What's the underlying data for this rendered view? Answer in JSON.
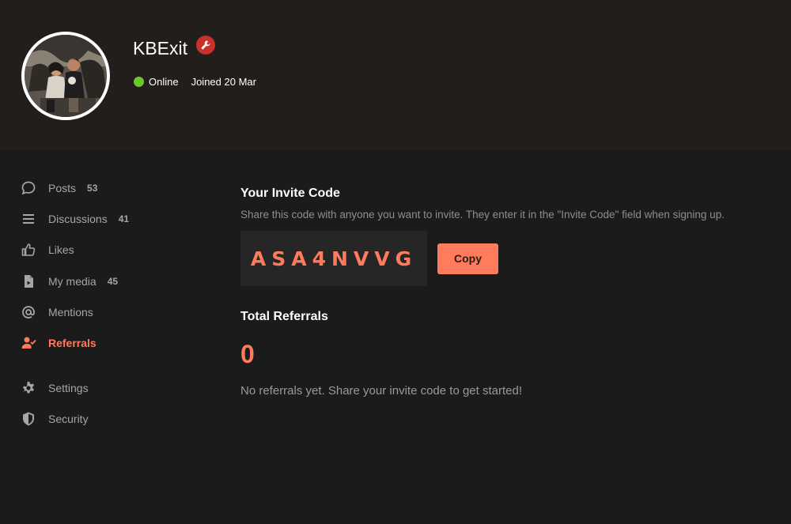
{
  "profile": {
    "username": "KBExit",
    "status": "Online",
    "joined": "Joined 20 Mar",
    "badge_icon": "wrench-icon",
    "status_color": "#6cc72f",
    "badge_color": "#c9302c"
  },
  "sidebar": {
    "items": [
      {
        "label": "Posts",
        "count": "53",
        "icon": "speech-bubble-icon",
        "active": false
      },
      {
        "label": "Discussions",
        "count": "41",
        "icon": "list-icon",
        "active": false
      },
      {
        "label": "Likes",
        "count": "",
        "icon": "thumbs-up-icon",
        "active": false
      },
      {
        "label": "My media",
        "count": "45",
        "icon": "media-file-icon",
        "active": false
      },
      {
        "label": "Mentions",
        "count": "",
        "icon": "at-sign-icon",
        "active": false
      },
      {
        "label": "Referrals",
        "count": "",
        "icon": "user-check-icon",
        "active": true
      },
      {
        "label": "Settings",
        "count": "",
        "icon": "gear-icon",
        "active": false
      },
      {
        "label": "Security",
        "count": "",
        "icon": "shield-icon",
        "active": false
      }
    ]
  },
  "invite": {
    "title": "Your Invite Code",
    "description": "Share this code with anyone you want to invite. They enter it in the \"Invite Code\" field when signing up.",
    "code": "ASA4NVVG",
    "copy_label": "Copy"
  },
  "referrals": {
    "title": "Total Referrals",
    "count": "0",
    "empty_text": "No referrals yet. Share your invite code to get started!"
  },
  "colors": {
    "accent": "#ff7b5c",
    "hero_bg": "#221e1c",
    "page_bg": "#1b1b1b"
  }
}
